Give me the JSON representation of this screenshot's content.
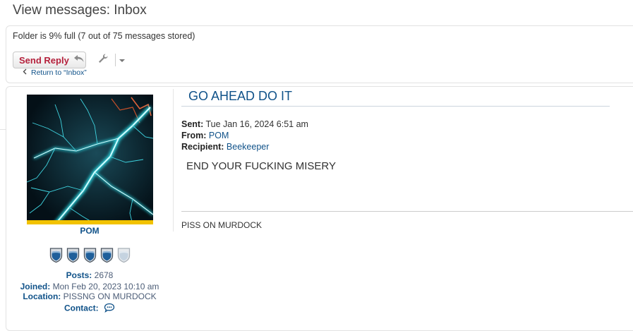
{
  "page": {
    "title": "View messages: Inbox"
  },
  "folder": {
    "status": "Folder is 9% full (7 out of 75 messages stored)"
  },
  "toolbar": {
    "send_reply_label": "Send Reply",
    "reply_icon": "reply-arrow-icon",
    "tools_icon": "wrench-icon",
    "dropdown_icon": "caret-down-icon",
    "return_label": "Return to “Inbox”",
    "return_icon": "chevron-left-icon"
  },
  "author": {
    "username": "POM",
    "avatar_icon": "lightning-avatar",
    "rank_icon": "shield-rank-icon",
    "rank_filled": 4,
    "rank_total": 5,
    "posts_label": "Posts:",
    "posts_value": "2678",
    "joined_label": "Joined:",
    "joined_value": "Mon Feb 20, 2023 10:10 am",
    "location_label": "Location:",
    "location_value": "PISSNG ON MURDOCK",
    "contact_label": "Contact:",
    "contact_icon": "speech-bubble-icon"
  },
  "message": {
    "subject": "GO AHEAD DO IT",
    "sent_label": "Sent:",
    "sent_value": "Tue Jan 16, 2024 6:51 am",
    "from_label": "From:",
    "from_value": "POM",
    "recipient_label": "Recipient:",
    "recipient_value": "Beekeeper",
    "body": "END YOUR FUCKING MISERY",
    "signature": "PISS ON MURDOCK"
  },
  "colors": {
    "link": "#105289",
    "send_reply": "#b5213c",
    "profile_text": "#4c5d77",
    "rank_fill": "#1f5f9a"
  }
}
